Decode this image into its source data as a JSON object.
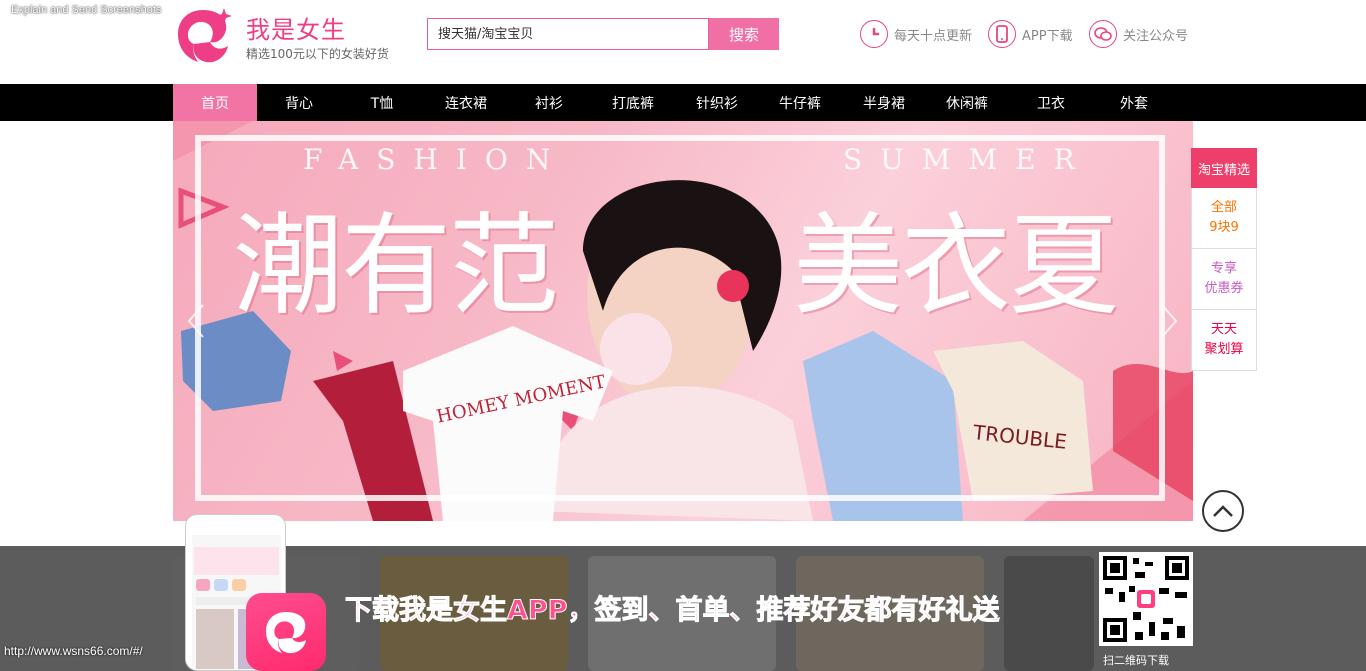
{
  "overlay": {
    "screenshot_tool_label": "Explain and Send Screenshots"
  },
  "header": {
    "site_title": "我是女生",
    "site_subtitle": "精选100元以下的女装好货",
    "search": {
      "placeholder": "搜天猫/淘宝宝贝",
      "button_label": "搜索"
    },
    "links": [
      {
        "label": "每天十点更新",
        "icon": "clock-icon"
      },
      {
        "label": "APP下载",
        "icon": "phone-icon"
      },
      {
        "label": "关注公众号",
        "icon": "wechat-icon"
      }
    ]
  },
  "nav": {
    "items": [
      {
        "label": "首页",
        "active": true
      },
      {
        "label": "背心"
      },
      {
        "label": "T恤"
      },
      {
        "label": "连衣裙"
      },
      {
        "label": "衬衫"
      },
      {
        "label": "打底裤"
      },
      {
        "label": "针织衫"
      },
      {
        "label": "牛仔裤"
      },
      {
        "label": "半身裙"
      },
      {
        "label": "休闲裤"
      },
      {
        "label": "卫衣"
      },
      {
        "label": "外套"
      }
    ]
  },
  "banner": {
    "en_left": "FASHION",
    "en_right": "SUMMER",
    "cn_left": "潮有范",
    "cn_right": "美衣夏",
    "tee_print": "HOMEY MOMENT",
    "tee2_print": "TROUBLE"
  },
  "side_widget": {
    "header": "淘宝精选",
    "items": [
      {
        "line1": "全部",
        "line2": "9块9"
      },
      {
        "line1": "专享",
        "line2": "优惠券"
      },
      {
        "line1": "天天",
        "line2": "聚划算"
      }
    ]
  },
  "promo": {
    "text": "下载我是女生APP，签到、首单、推荐好友都有好礼送",
    "qr_caption": "扫二维码下载"
  },
  "status": {
    "url": "http://www.wsns66.com/#/"
  },
  "colors": {
    "brand_pink": "#ee3f86",
    "nav_bg": "#000000",
    "nav_active": "#f274a4",
    "search_btn": "#f06fa5"
  }
}
